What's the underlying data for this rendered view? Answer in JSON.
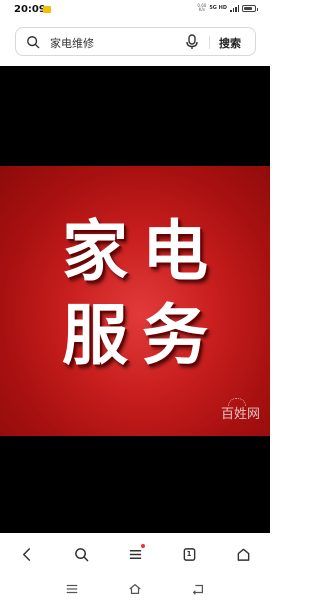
{
  "status_bar": {
    "time": "20:09",
    "net_speed_value": "0.60",
    "net_speed_unit": "K/s",
    "network": "5G HD"
  },
  "search": {
    "query": "家电维修",
    "button_label": "搜索"
  },
  "banner": {
    "line1": "家电",
    "line2": "服务",
    "background_color": "#c81e1e",
    "watermark": "百姓网"
  },
  "toolbar": {
    "tab_count": "1",
    "icons": [
      "back-icon",
      "search-icon",
      "menu-icon",
      "tabs-icon",
      "home-icon"
    ]
  },
  "nav_bar": {
    "icons": [
      "recents-icon",
      "home-icon",
      "back-icon"
    ]
  }
}
